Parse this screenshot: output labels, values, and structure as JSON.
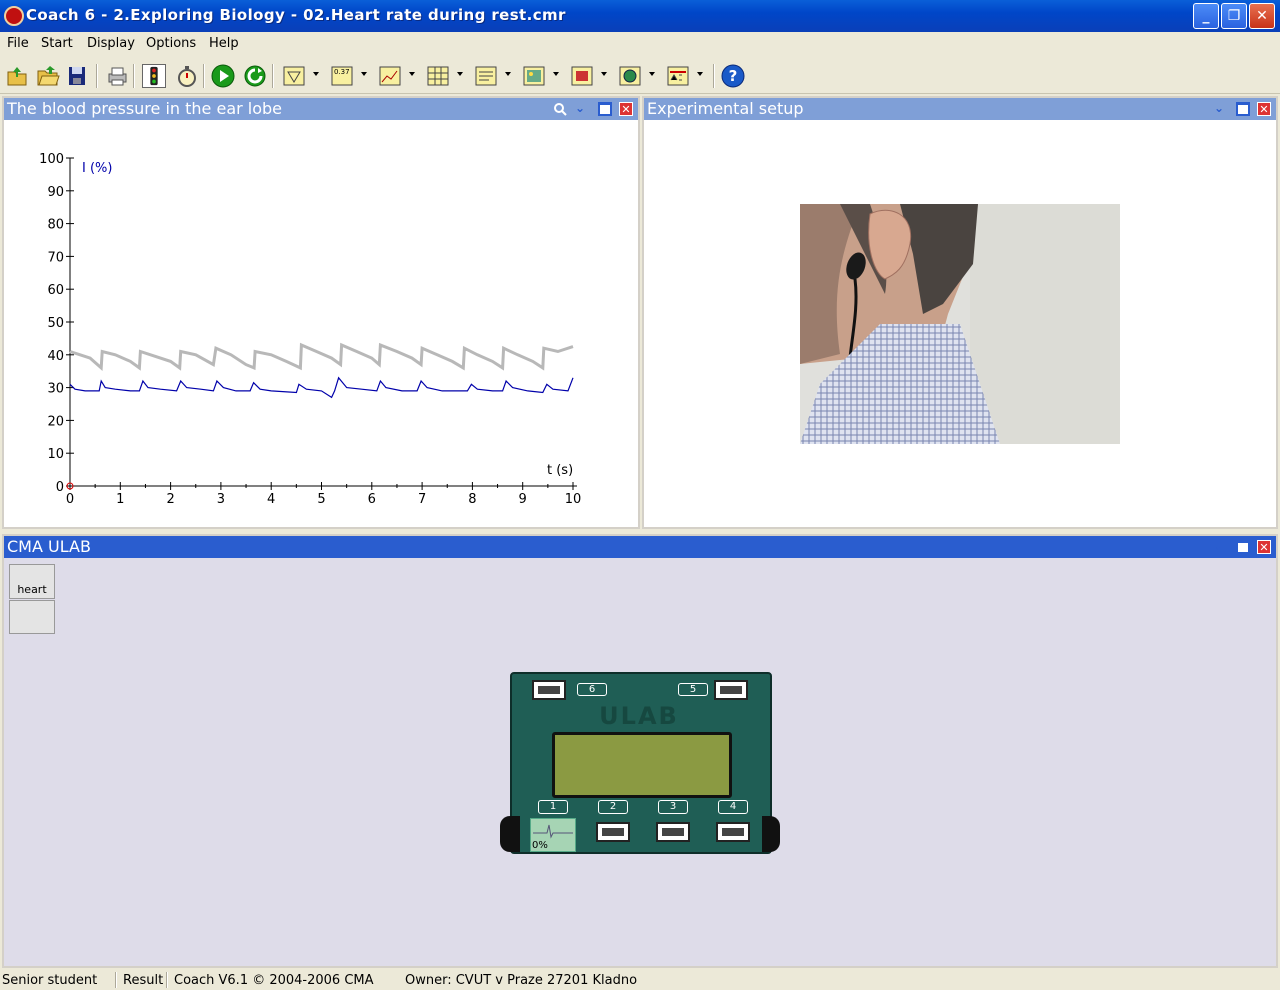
{
  "window": {
    "title": "Coach 6 - 2.Exploring Biology - 02.Heart rate during rest.cmr",
    "minimize": "_",
    "maximize": "❐",
    "close": "✕"
  },
  "menu": [
    "File",
    "Start",
    "Display",
    "Options",
    "Help"
  ],
  "toolbar_icons": [
    "new-activity-icon",
    "open-folder-icon",
    "save-icon",
    "print-icon",
    "traffic-light-icon",
    "stopwatch-icon",
    "start-measurement-icon",
    "start-continue-icon",
    "diagram-icon",
    "value-display-icon",
    "graph-icon",
    "table-icon",
    "text-icon",
    "picture-icon",
    "video-icon",
    "sensor-icon",
    "abc-icon",
    "help-icon"
  ],
  "help_glyph": "?",
  "value_label": "0.37",
  "graph_panel": {
    "title": "The blood pressure in the ear lobe"
  },
  "setup_panel": {
    "title": "Experimental setup"
  },
  "ulab_panel": {
    "title": "CMA ULAB",
    "sensor_slots": [
      "heart",
      ""
    ],
    "device_label": "ULAB",
    "ports_top": [
      "6",
      "5"
    ],
    "ports_bottom": [
      "1",
      "2",
      "3",
      "4"
    ],
    "sensor_reading": "0%"
  },
  "chart_data": {
    "type": "line",
    "title": "",
    "xlabel": "t (s)",
    "ylabel": "I (%)",
    "xlim": [
      0,
      10
    ],
    "ylim": [
      0,
      100
    ],
    "xticks": [
      0,
      1,
      2,
      3,
      4,
      5,
      6,
      7,
      8,
      9,
      10
    ],
    "yticks": [
      0,
      10,
      20,
      30,
      40,
      50,
      60,
      70,
      80,
      90,
      100
    ],
    "series": [
      {
        "name": "",
        "color": "#b8b8b8",
        "x": [
          0,
          0.2,
          0.4,
          0.62,
          0.64,
          0.9,
          1.2,
          1.38,
          1.4,
          1.7,
          2.0,
          2.18,
          2.2,
          2.5,
          2.85,
          2.9,
          3.2,
          3.5,
          3.66,
          3.68,
          4.0,
          4.3,
          4.58,
          4.6,
          4.9,
          5.2,
          5.38,
          5.4,
          5.7,
          6.0,
          6.15,
          6.17,
          6.5,
          6.8,
          6.98,
          7.0,
          7.3,
          7.6,
          7.82,
          7.84,
          8.1,
          8.4,
          8.6,
          8.62,
          8.9,
          9.2,
          9.4,
          9.42,
          9.7,
          10.0
        ],
        "y": [
          41,
          40,
          39,
          36,
          41,
          40,
          38,
          36,
          41,
          39.5,
          38,
          36,
          41,
          40,
          37,
          42,
          40,
          37,
          36,
          41,
          40,
          38,
          36,
          43,
          41,
          39,
          37,
          43,
          41,
          39,
          37,
          43,
          41,
          39,
          37,
          42,
          40,
          38,
          36,
          42,
          40,
          38,
          36,
          42,
          40,
          38,
          36,
          42,
          41,
          42.5
        ]
      },
      {
        "name": "",
        "color": "#0000aa",
        "x": [
          0,
          0.1,
          0.3,
          0.58,
          0.62,
          0.7,
          0.9,
          1.2,
          1.38,
          1.45,
          1.55,
          1.8,
          2.12,
          2.2,
          2.32,
          2.6,
          2.85,
          2.92,
          3.05,
          3.3,
          3.58,
          3.65,
          3.78,
          4.0,
          4.5,
          4.55,
          4.7,
          5.0,
          5.2,
          5.26,
          5.34,
          5.5,
          5.8,
          6.1,
          6.17,
          6.28,
          6.6,
          6.9,
          6.98,
          7.1,
          7.4,
          7.9,
          7.98,
          8.1,
          8.4,
          8.6,
          8.67,
          8.8,
          9.1,
          9.4,
          9.48,
          9.6,
          9.9,
          10.0
        ],
        "y": [
          31,
          29.5,
          29,
          29,
          32,
          30,
          29.5,
          29,
          29,
          32,
          30,
          29.5,
          29,
          32,
          30,
          29.5,
          29,
          32,
          30,
          29,
          29,
          31.5,
          29.5,
          29,
          28.5,
          31,
          29.5,
          29,
          27,
          29,
          33,
          30,
          29.5,
          29,
          32,
          30,
          29,
          29,
          32,
          30,
          29,
          29,
          31,
          29.5,
          29,
          29,
          32,
          30,
          29,
          28.5,
          31,
          29.5,
          29,
          33
        ]
      }
    ]
  }
}
